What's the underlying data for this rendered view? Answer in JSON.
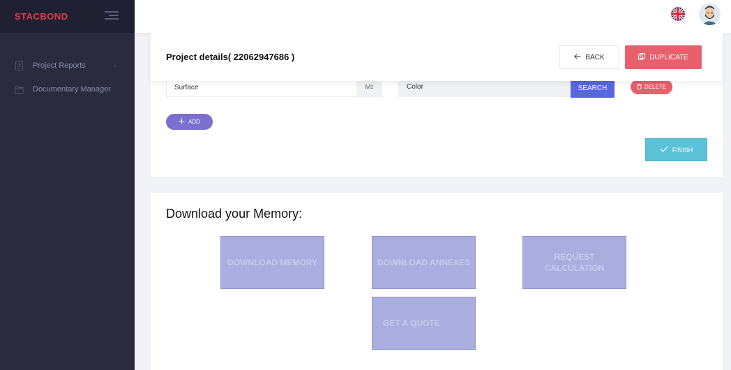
{
  "brand": {
    "name": "STACBOND",
    "color": "#e03c44"
  },
  "sidebar": {
    "items": [
      {
        "label": "Project Reports",
        "icon": "document-icon",
        "has_chevron": true
      },
      {
        "label": "Documentary Manager",
        "icon": "folder-icon",
        "has_chevron": false
      }
    ]
  },
  "topbar": {
    "language_icon": "uk-flag-icon",
    "avatar_icon": "user-avatar"
  },
  "project": {
    "title": "Project details( 22062947686 )",
    "back_label": "BACK",
    "duplicate_label": "DUPLICATE"
  },
  "form": {
    "surface_value": "Surface",
    "surface_unit": "M",
    "surface_unit_exp": "2",
    "color_value": "Color",
    "search_label": "SEARCH",
    "delete_label": "DELETE",
    "add_label": "ADD",
    "finish_label": "FINISH"
  },
  "download": {
    "title": "Download your Memory:",
    "buttons": [
      {
        "label": "DOWNLOAD MEMORY"
      },
      {
        "label": "DOWNLOAD ANNEXES"
      },
      {
        "label": "REQUEST CALCULATION"
      },
      {
        "label": "GET A QUOTE"
      }
    ]
  },
  "colors": {
    "sidebar_bg": "#2a2c3e",
    "primary": "#5867dd",
    "danger": "#e8606b",
    "info": "#5bc2d8",
    "accent": "#7b70d0",
    "disabled_btn": "#a9aede"
  }
}
